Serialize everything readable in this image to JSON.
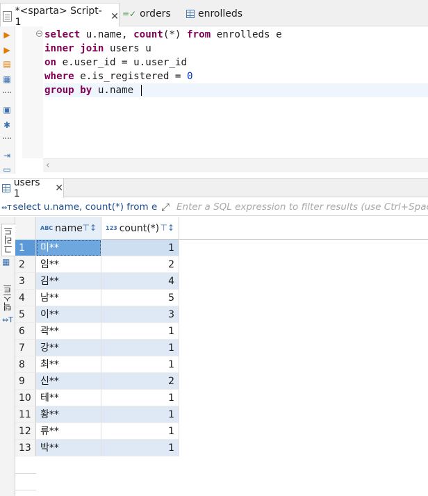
{
  "tabs": [
    {
      "label": "*<sparta> Script-1",
      "active": true
    },
    {
      "label": "orders",
      "active": false
    },
    {
      "label": "enrolleds",
      "active": false
    }
  ],
  "editor": {
    "lines": [
      {
        "parts": [
          {
            "t": "select",
            "kw": true
          },
          {
            "t": " u.name, "
          },
          {
            "t": "count",
            "kw": true
          },
          {
            "t": "(*) "
          },
          {
            "t": "from",
            "kw": true
          },
          {
            "t": " enrolleds e"
          }
        ]
      },
      {
        "parts": [
          {
            "t": "inner join",
            "kw": true
          },
          {
            "t": " users u"
          }
        ]
      },
      {
        "parts": [
          {
            "t": "on",
            "kw": true
          },
          {
            "t": " e.user_id = u.user_id"
          }
        ]
      },
      {
        "parts": [
          {
            "t": "where",
            "kw": true
          },
          {
            "t": " e.is_registered = "
          },
          {
            "t": "0",
            "num": true
          }
        ]
      },
      {
        "parts": [
          {
            "t": "group by",
            "kw": true
          },
          {
            "t": " u.name "
          }
        ]
      }
    ]
  },
  "results": {
    "tab_label": "users 1",
    "query_preview": "select u.name, count(*) from e",
    "filter_placeholder": "Enter a SQL expression to filter results (use Ctrl+Space)",
    "side_tabs": [
      "그리드",
      "텍스트"
    ],
    "columns": [
      {
        "label": "name",
        "type": "ABC"
      },
      {
        "label": "count(*)",
        "type": "123"
      }
    ],
    "rows": [
      [
        "1",
        "미**",
        "1"
      ],
      [
        "2",
        "임**",
        "2"
      ],
      [
        "3",
        "김**",
        "4"
      ],
      [
        "4",
        "남**",
        "5"
      ],
      [
        "5",
        "이**",
        "3"
      ],
      [
        "6",
        "곽**",
        "1"
      ],
      [
        "7",
        "강**",
        "1"
      ],
      [
        "8",
        "최**",
        "1"
      ],
      [
        "9",
        "신**",
        "2"
      ],
      [
        "10",
        "테**",
        "1"
      ],
      [
        "11",
        "황**",
        "1"
      ],
      [
        "12",
        "류**",
        "1"
      ],
      [
        "13",
        "박**",
        "1"
      ]
    ]
  },
  "colors": {
    "keyword": "#7f0055",
    "number": "#0033cc",
    "accent": "#1d4f91",
    "selection": "#6ea6de"
  }
}
